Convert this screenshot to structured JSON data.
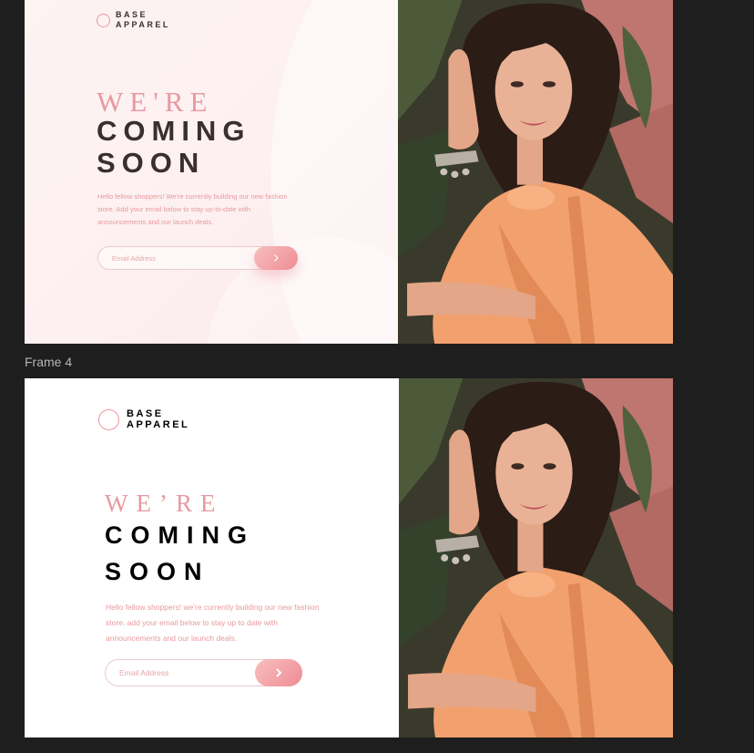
{
  "canvas": {
    "frame_label": "Frame 4"
  },
  "frame_top": {
    "logo": {
      "line1": "BASE",
      "line2": "APPAREL"
    },
    "heading": {
      "light": "WE'RE",
      "line2": "COMING",
      "line3": "SOON"
    },
    "description": "Hello fellow shoppers! We're currently building our new fashion store. Add your email below to stay up-to-date with announcements and our launch deals.",
    "email": {
      "placeholder": "Email Address",
      "value": ""
    },
    "submit_icon": "chevron-right-icon",
    "hero_image": "woman-orange-shirt-photo"
  },
  "frame_bottom": {
    "logo": {
      "line1": "BASE",
      "line2": "APPAREL"
    },
    "heading": {
      "light": "WE’RE",
      "line2": "COMING",
      "line3": "SOON"
    },
    "description": "Hello fellow shoppers! we're currently building our new fashion store. add your email below to stay up to date with announcements and our launch deals.",
    "email": {
      "placeholder": "Email Address",
      "value": ""
    },
    "submit_icon": "chevron-right-icon",
    "hero_image": "woman-orange-shirt-photo"
  },
  "colors": {
    "canvas_bg": "#1e1e1e",
    "accent_pink": "#e89a9f",
    "button_gradient_start": "#f8bfbf",
    "button_gradient_end": "#ee8c94",
    "dark_text_top": "#3a2f30",
    "dark_text_bottom": "#000000",
    "shirt_orange": "#f3a06f"
  }
}
